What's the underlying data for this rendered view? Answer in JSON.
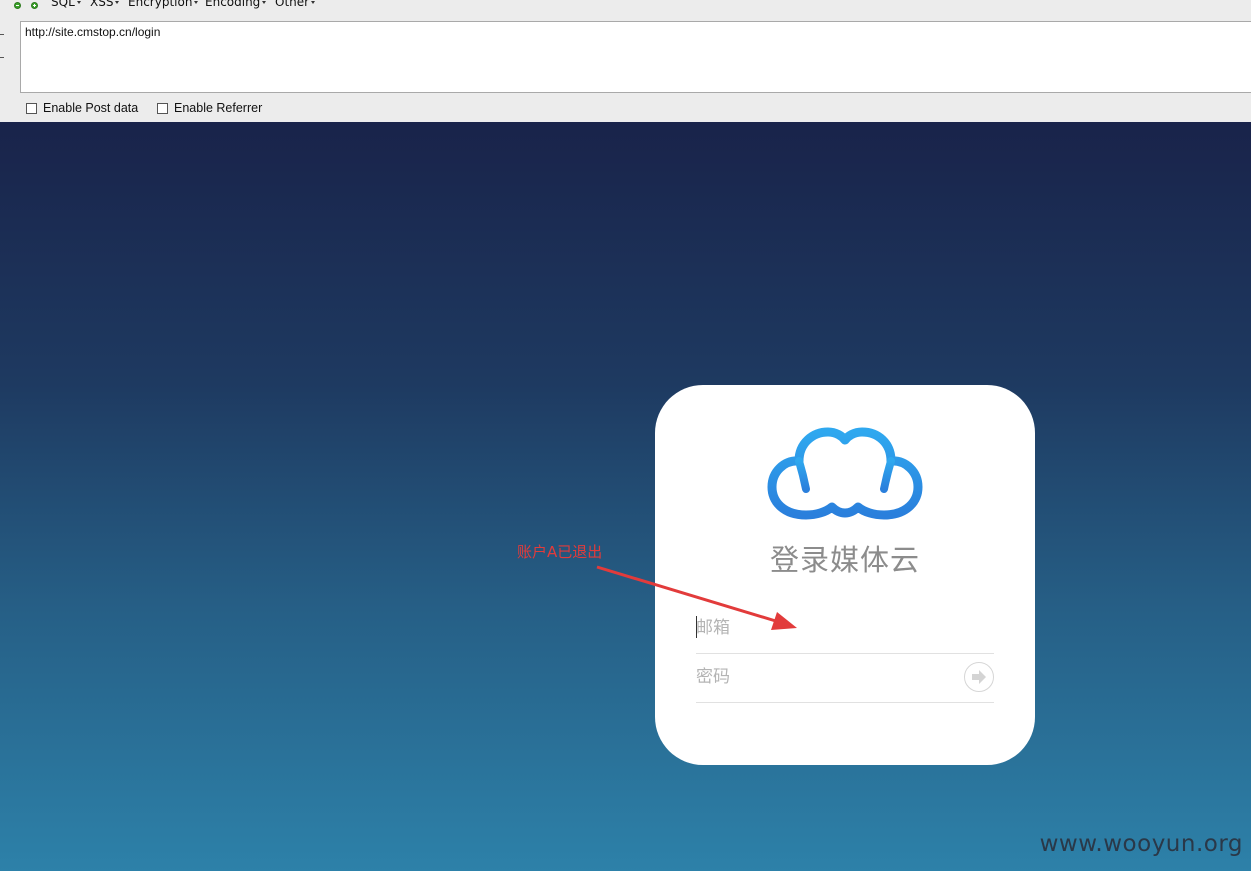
{
  "hackbar": {
    "menu": [
      {
        "label": "SQL"
      },
      {
        "label": "XSS"
      },
      {
        "label": "Encryption"
      },
      {
        "label": "Encoding"
      },
      {
        "label": "Other"
      }
    ],
    "url": "http://site.cmstop.cn/login",
    "options": {
      "post_data": "Enable Post data",
      "referrer": "Enable Referrer"
    }
  },
  "login": {
    "title": "登录媒体云",
    "email_placeholder": "邮箱",
    "password_placeholder": "密码",
    "submit_icon": "arrow-right-icon",
    "logo_icon": "cloud-icon"
  },
  "annotation": {
    "text": "账户A已退出"
  },
  "watermark": "www.wooyun.org",
  "colors": {
    "logo_blue": "#2e8fe0",
    "annotation_red": "#e23b3b",
    "bg_top": "#19234a",
    "bg_bottom": "#2d81a9"
  }
}
